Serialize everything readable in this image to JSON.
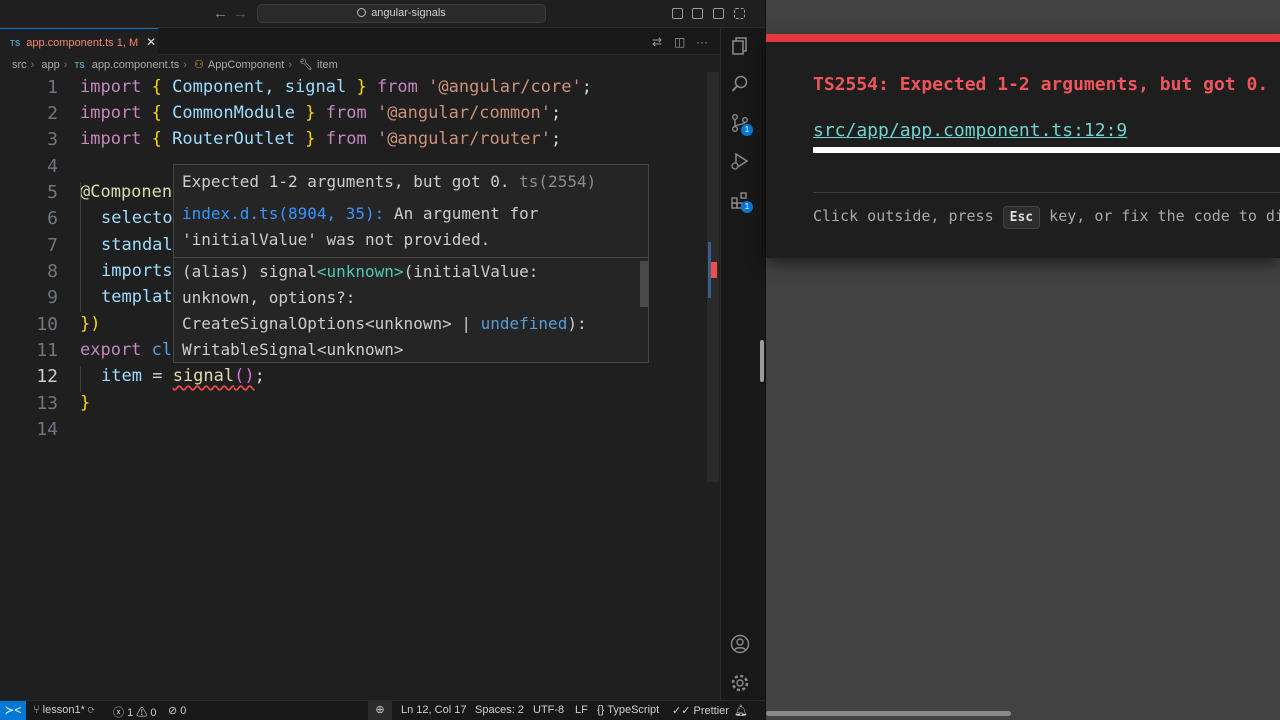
{
  "titlebar": {
    "search_text": "angular-signals",
    "back": "←",
    "forward": "→"
  },
  "tab": {
    "lang": "TS",
    "label": "app.component.ts",
    "status": "1, M",
    "close": "✕"
  },
  "breadcrumb": {
    "src": "src",
    "app": "app",
    "lang": "TS",
    "file": "app.component.ts",
    "class": "AppComponent",
    "member": "item"
  },
  "editor": {
    "line_numbers": [
      "1",
      "2",
      "3",
      "4",
      "5",
      "6",
      "7",
      "8",
      "9",
      "10",
      "11",
      "12",
      "13",
      "14"
    ],
    "lines": {
      "l1": {
        "kw1": "import",
        "b1": "{",
        "id1": "Component,",
        "id2": "signal",
        "b2": "}",
        "kw2": "from",
        "st": "'@angular/core'",
        "end": ";"
      },
      "l2": {
        "kw1": "import",
        "b1": "{",
        "id1": "CommonModule",
        "b2": "}",
        "kw2": "from",
        "st": "'@angular/common'",
        "end": ";"
      },
      "l3": {
        "kw1": "import",
        "b1": "{",
        "id1": "RouterOutlet",
        "b2": "}",
        "kw2": "from",
        "st": "'@angular/router'",
        "end": ";"
      },
      "l5": "@Componen",
      "l6": "selecto",
      "l7": "standal",
      "l8": "imports",
      "l9": "templat",
      "l10": {
        "b": "})"
      },
      "l11": {
        "kw": "export",
        "rest": "cl"
      },
      "l12": {
        "id": "item",
        "eq": "=",
        "fn": "signal",
        "pn": "()",
        "end": ";"
      },
      "l13": {
        "b": "}"
      }
    }
  },
  "hover": {
    "message": "Expected 1-2 arguments, but got 0.",
    "code": "ts(2554)",
    "ref_link": "index.d.ts(8904, 35):",
    "ref_text": "An argument for",
    "ref_text2": "'initialValue' was not provided.",
    "sig1a": "(alias) signal",
    "sig1b": "<unknown>",
    "sig1c": "(initialValue:",
    "sig2": "unknown, options?:",
    "sig3a": "CreateSignalOptions<unknown> |",
    "sig3b": "undefined",
    "sig3c": "):",
    "sig4": "WritableSignal<unknown>"
  },
  "activity": {
    "badge1": "1",
    "badge2": "1"
  },
  "overlay": {
    "title": "TS2554: Expected 1-2 arguments, but got 0.",
    "link": "src/app/app.component.ts:12:9",
    "hint_pre": "Click outside, press",
    "hint_key": "Esc",
    "hint_post": "key, or fix the code to dismiss."
  },
  "status": {
    "branch": "lesson1*",
    "errors": "1",
    "warnings": "0",
    "ports": "0",
    "position": "Ln 12, Col 17",
    "spaces": "Spaces: 2",
    "encoding": "UTF-8",
    "eol": "LF",
    "language": "TypeScript",
    "prettier": "Prettier"
  }
}
